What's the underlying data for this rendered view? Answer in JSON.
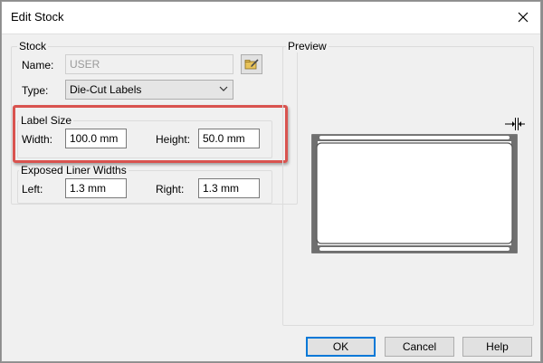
{
  "window": {
    "title": "Edit Stock"
  },
  "stock": {
    "legend": "Stock",
    "name_label": "Name:",
    "name_value": "USER",
    "type_label": "Type:",
    "type_value": "Die-Cut Labels"
  },
  "label_size": {
    "legend": "Label Size",
    "width_label": "Width:",
    "width_value": "100.0 mm",
    "height_label": "Height:",
    "height_value": "50.0 mm"
  },
  "liner": {
    "legend": "Exposed Liner Widths",
    "left_label": "Left:",
    "left_value": "1.3 mm",
    "right_label": "Right:",
    "right_value": "1.3 mm"
  },
  "preview": {
    "legend": "Preview"
  },
  "buttons": {
    "ok": "OK",
    "cancel": "Cancel",
    "help": "Help"
  },
  "colors": {
    "highlight": "#d9534f",
    "default_button_border": "#0078d7"
  }
}
